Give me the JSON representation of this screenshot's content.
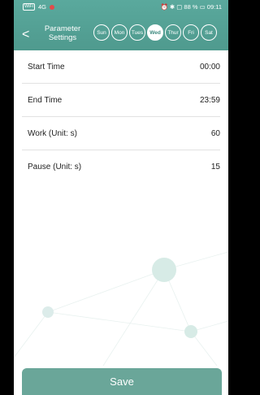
{
  "status_bar": {
    "sim": "WiFi",
    "network": "4G",
    "right_text": "⏰ ✱ ▢ 88 % ▭ 09:11"
  },
  "header": {
    "back_glyph": "<",
    "title_line1": "Parameter",
    "title_line2": "Settings"
  },
  "days": [
    {
      "label": "Sun",
      "selected": false
    },
    {
      "label": "Mon",
      "selected": false
    },
    {
      "label": "Tues",
      "selected": false
    },
    {
      "label": "Wed",
      "selected": true
    },
    {
      "label": "Thur",
      "selected": false
    },
    {
      "label": "Fri",
      "selected": false
    },
    {
      "label": "Sat",
      "selected": false
    }
  ],
  "settings": [
    {
      "label": "Start Time",
      "value": "00:00"
    },
    {
      "label": "End Time",
      "value": "23:59"
    },
    {
      "label": "Work (Unit: s)",
      "value": "60"
    },
    {
      "label": "Pause (Unit: s)",
      "value": "15"
    }
  ],
  "save_label": "Save",
  "colors": {
    "header": "#5aa99d",
    "save": "#6aa699",
    "selected_day_text": "#3e8b80"
  }
}
